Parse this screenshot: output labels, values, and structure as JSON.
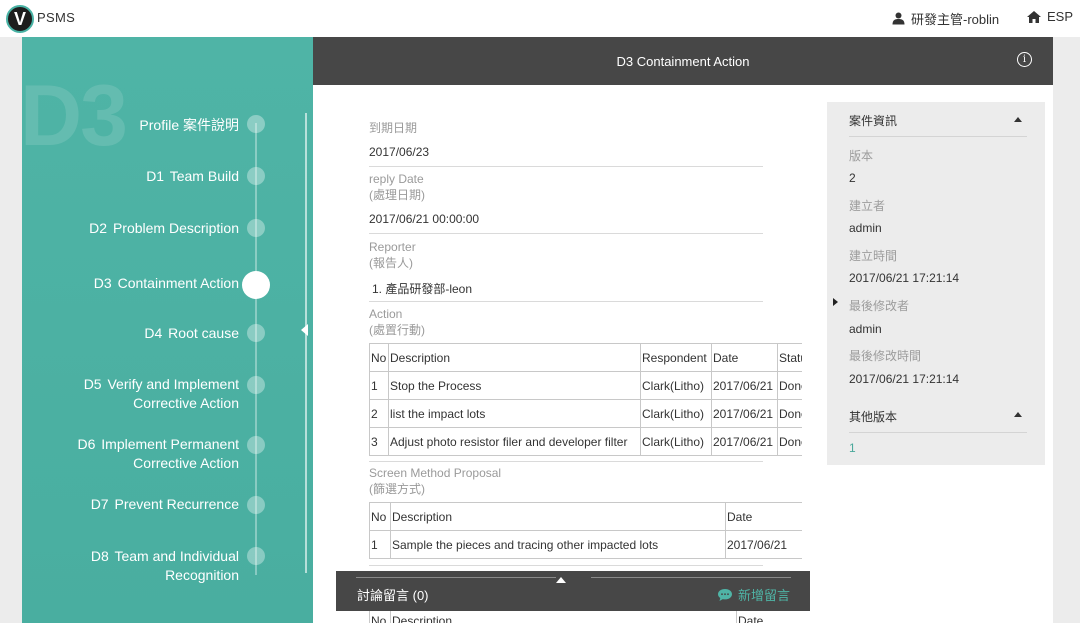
{
  "app": {
    "logo_letter": "V",
    "name": "PSMS"
  },
  "topbar": {
    "user": "研發主管-roblin",
    "home_label": "ESP"
  },
  "sidebar": {
    "watermark": "D3",
    "steps": [
      {
        "prefix": "",
        "label": "Profile 案件說明"
      },
      {
        "prefix": "D1",
        "label": "Team Build"
      },
      {
        "prefix": "D2",
        "label": "Problem Description"
      },
      {
        "prefix": "D3",
        "label": "Containment Action",
        "active": true
      },
      {
        "prefix": "D4",
        "label": "Root cause"
      },
      {
        "prefix": "D5",
        "label": "Verify and Implement",
        "label2": "Corrective Action"
      },
      {
        "prefix": "D6",
        "label": "Implement Permanent",
        "label2": "Corrective Action"
      },
      {
        "prefix": "D7",
        "label": "Prevent Recurrence"
      },
      {
        "prefix": "D8",
        "label": "Team and Individual",
        "label2": "Recognition"
      }
    ]
  },
  "header": {
    "title": "D3 Containment Action",
    "info_icon": "info-icon"
  },
  "fields": {
    "due_label": "到期日期",
    "due_value": "2017/06/23",
    "reply_label": "reply Date",
    "reply_label_zh": "(處理日期)",
    "reply_value": "2017/06/21 00:00:00",
    "reporter_label": "Reporter",
    "reporter_label_zh": "(報告人)",
    "reporter_value": "1. 產品研發部-leon",
    "action_label": "Action",
    "action_label_zh": "(處置行動)",
    "screen_label": "Screen Method Proposal",
    "screen_label_zh": "(篩選方式)"
  },
  "action_table": {
    "headers": [
      "No",
      "Description",
      "Respondent",
      "Date",
      "Status"
    ],
    "rows": [
      [
        "1",
        "Stop the Process",
        "Clark(Litho)",
        "2017/06/21",
        "Done"
      ],
      [
        "2",
        "list the impact lots",
        "Clark(Litho)",
        "2017/06/21",
        "Done"
      ],
      [
        "3",
        "Adjust photo resistor filer and developer filter",
        "Clark(Litho)",
        "2017/06/21",
        "Done"
      ]
    ]
  },
  "screen_table": {
    "headers": [
      "No",
      "Description",
      "Date"
    ],
    "rows": [
      [
        "1",
        "Sample the pieces and tracing other impacted lots",
        "2017/06/21"
      ]
    ]
  },
  "next_table": {
    "headers": [
      "No",
      "Description",
      "Date"
    ]
  },
  "case_info": {
    "title": "案件資訊",
    "version_label": "版本",
    "version_value": "2",
    "creator_label": "建立者",
    "creator_value": "admin",
    "created_label": "建立時間",
    "created_value": "2017/06/21 17:21:14",
    "modifier_label": "最後修改者",
    "modifier_value": "admin",
    "modified_label": "最後修改時間",
    "modified_value": "2017/06/21 17:21:14",
    "other_title": "其他版本",
    "other_link": "1"
  },
  "discussion": {
    "label": "討論留言 (0)",
    "add_label": "新增留言"
  },
  "colors": {
    "teal": "#4fb4a6",
    "header": "#474747"
  }
}
